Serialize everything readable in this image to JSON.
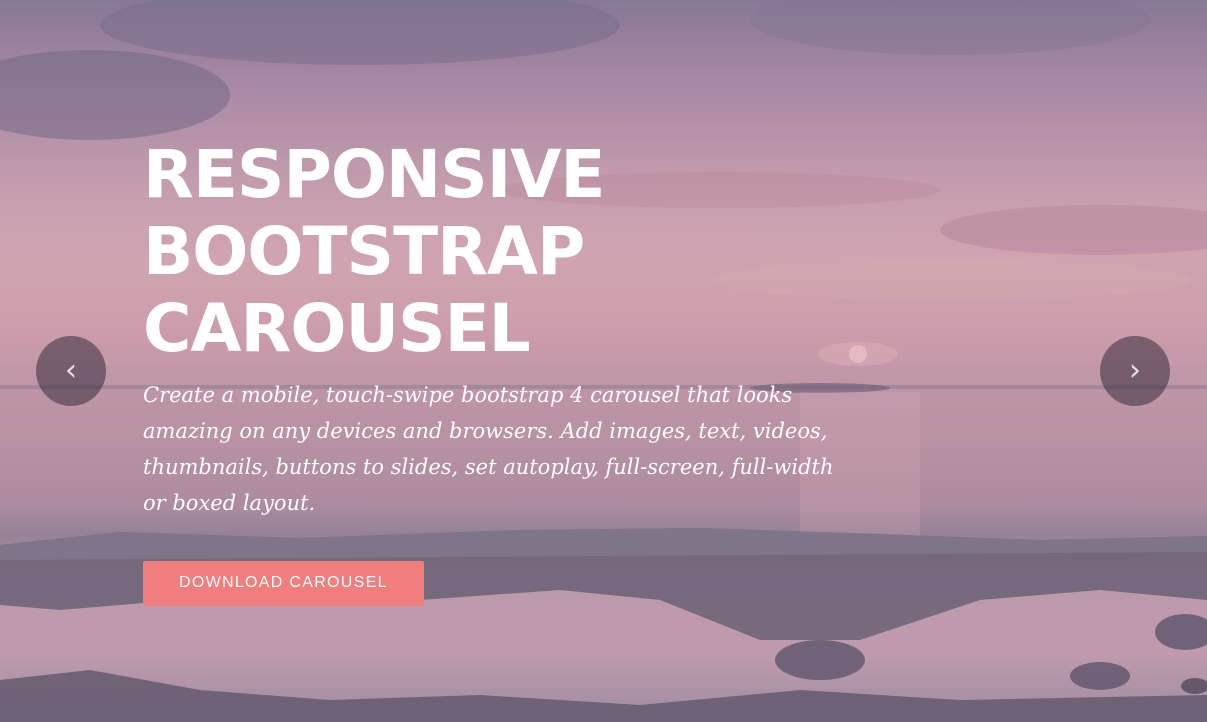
{
  "slide": {
    "title": "RESPONSIVE BOOTSTRAP CAROUSEL",
    "description": "Create a mobile, touch-swipe bootstrap 4 carousel that looks amazing on any devices and browsers. Add images, text, videos, thumbnails, buttons to slides, set autoplay, full-screen, full-width or boxed layout.",
    "button_label": "DOWNLOAD CAROUSEL",
    "background_scene": "sunset-sea-rocks"
  },
  "controls": {
    "prev_icon": "‹",
    "next_icon": "›",
    "prev_icon_name": "chevron-left-icon",
    "next_icon_name": "chevron-right-icon"
  },
  "colors": {
    "button": "#f07e7d",
    "text": "#ffffff",
    "control_bg": "rgba(55,45,60,0.55)"
  }
}
